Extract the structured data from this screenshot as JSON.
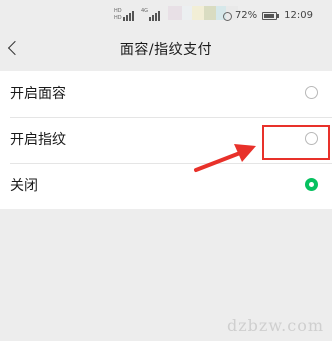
{
  "status_bar": {
    "battery_percent": "72%",
    "time": "12:09"
  },
  "header": {
    "title": "面容/指纹支付"
  },
  "options": [
    {
      "label": "开启面容",
      "selected": false
    },
    {
      "label": "开启指纹",
      "selected": false
    },
    {
      "label": "关闭",
      "selected": true
    }
  ],
  "watermark": "dzbzw.com",
  "colors": {
    "accent_green": "#07c160",
    "annotation_red": "#e8312a",
    "background": "#ededed"
  },
  "icons": {
    "back": "chevron-left-icon",
    "battery": "battery-icon",
    "alarm": "alarm-icon"
  }
}
